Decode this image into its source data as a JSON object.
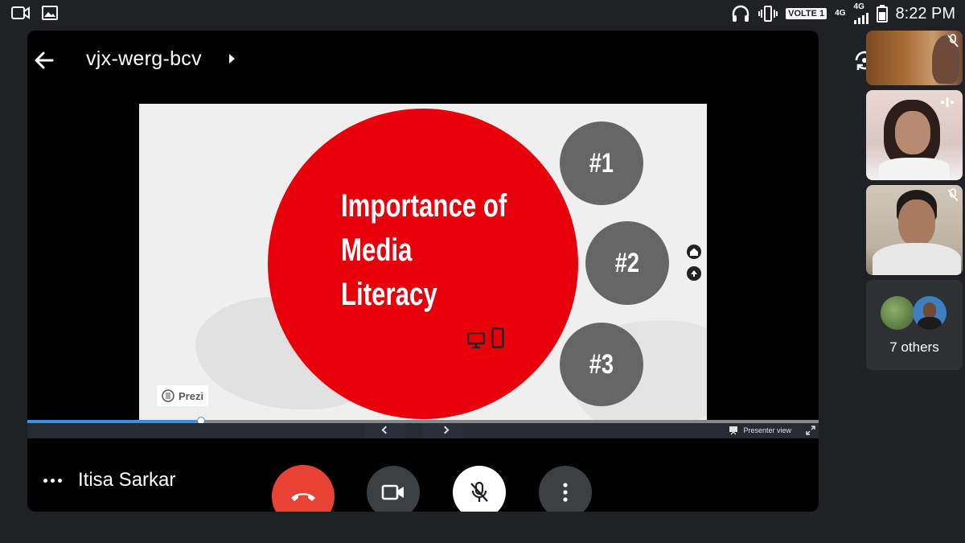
{
  "status_bar": {
    "time": "8:22 PM",
    "volte": "VOLTE 1",
    "network_1": "4G",
    "network_2": "4G",
    "icons": [
      "screen-record-icon",
      "gallery-icon",
      "headset-icon",
      "vibrate-icon",
      "signal-icon",
      "battery-icon"
    ]
  },
  "meeting": {
    "code": "vjx-werg-bcv"
  },
  "presentation": {
    "title_lines": [
      "Importance of",
      "Media",
      "Literacy"
    ],
    "topics": [
      "#1",
      "#2",
      "#3"
    ],
    "brand": "Prezi",
    "presenter_view_label": "Presenter view",
    "progress": 0.22,
    "colors": {
      "accent_red": "#e8000b",
      "topic_gray": "#666666",
      "progress_blue": "#3b8fe5"
    }
  },
  "presenter": {
    "name": "Itisa Sarkar"
  },
  "controls": {
    "buttons": [
      "end-call",
      "camera",
      "microphone-off",
      "more-options"
    ],
    "colors": {
      "end_call": "#e84235",
      "mic_bg": "#ffffff",
      "control_bg": "#3c4043"
    }
  },
  "participants": {
    "others_label": "7 others"
  }
}
